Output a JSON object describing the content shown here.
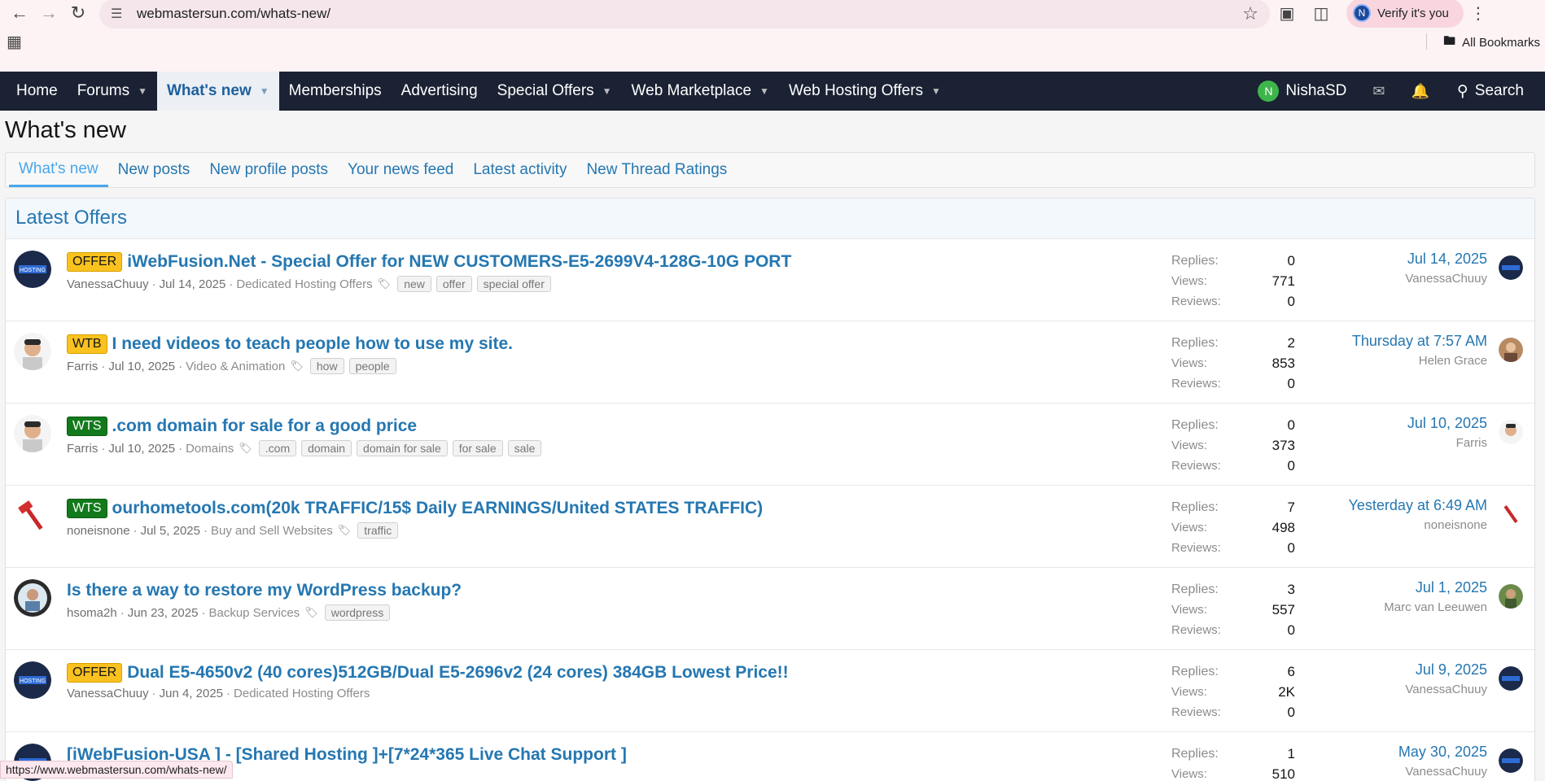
{
  "browser": {
    "url": "webmastersun.com/whats-new/",
    "profile_label": "Verify it's you",
    "profile_initial": "N",
    "all_bookmarks": "All Bookmarks",
    "status_url": "https://www.webmastersun.com/whats-new/"
  },
  "nav": {
    "items": [
      {
        "label": "Home"
      },
      {
        "label": "Forums"
      },
      {
        "label": "What's new"
      },
      {
        "label": "Memberships"
      },
      {
        "label": "Advertising"
      },
      {
        "label": "Special Offers"
      },
      {
        "label": "Web Marketplace"
      },
      {
        "label": "Web Hosting Offers"
      }
    ],
    "user_initial": "N",
    "username": "NishaSD",
    "search_label": "Search"
  },
  "page": {
    "title": "What's new",
    "tabs": [
      {
        "label": "What's new"
      },
      {
        "label": "New posts"
      },
      {
        "label": "New profile posts"
      },
      {
        "label": "Your news feed"
      },
      {
        "label": "Latest activity"
      },
      {
        "label": "New Thread Ratings"
      }
    ],
    "block_title": "Latest Offers"
  },
  "labels": {
    "replies": "Replies:",
    "views": "Views:",
    "reviews": "Reviews:"
  },
  "threads": [
    {
      "prefix": "OFFER",
      "title": "iWebFusion.Net - Special Offer for NEW CUSTOMERS-E5-2699V4-128G-10G PORT",
      "author": "VanessaChuuy",
      "date": "Jul 14, 2025",
      "forum": "Dedicated Hosting Offers",
      "tags": [
        "new",
        "offer",
        "special offer"
      ],
      "replies": "0",
      "views": "771",
      "reviews": "0",
      "last_date": "Jul 14, 2025",
      "last_user": "VanessaChuuy"
    },
    {
      "prefix": "WTB",
      "title": "I need videos to teach people how to use my site.",
      "author": "Farris",
      "date": "Jul 10, 2025",
      "forum": "Video & Animation",
      "tags": [
        "how",
        "people"
      ],
      "replies": "2",
      "views": "853",
      "reviews": "0",
      "last_date": "Thursday at 7:57 AM",
      "last_user": "Helen Grace"
    },
    {
      "prefix": "WTS",
      "title": ".com domain for sale for a good price",
      "author": "Farris",
      "date": "Jul 10, 2025",
      "forum": "Domains",
      "tags": [
        ".com",
        "domain",
        "domain for sale",
        "for sale",
        "sale"
      ],
      "replies": "0",
      "views": "373",
      "reviews": "0",
      "last_date": "Jul 10, 2025",
      "last_user": "Farris"
    },
    {
      "prefix": "WTS",
      "title": "ourhometools.com(20k TRAFFIC/15$ Daily EARNINGS/United STATES TRAFFIC)",
      "author": "noneisnone",
      "date": "Jul 5, 2025",
      "forum": "Buy and Sell Websites",
      "tags": [
        "traffic"
      ],
      "replies": "7",
      "views": "498",
      "reviews": "0",
      "last_date": "Yesterday at 6:49 AM",
      "last_user": "noneisnone"
    },
    {
      "prefix": "",
      "title": "Is there a way to restore my WordPress backup?",
      "author": "hsoma2h",
      "date": "Jun 23, 2025",
      "forum": "Backup Services",
      "tags": [
        "wordpress"
      ],
      "replies": "3",
      "views": "557",
      "reviews": "0",
      "last_date": "Jul 1, 2025",
      "last_user": "Marc van Leeuwen"
    },
    {
      "prefix": "OFFER",
      "title": "Dual E5-4650v2  (40 cores)512GB/Dual E5-2696v2 (24 cores) 384GB Lowest Price!!",
      "author": "VanessaChuuy",
      "date": "Jun 4, 2025",
      "forum": "Dedicated Hosting Offers",
      "tags": [],
      "replies": "6",
      "views": "2K",
      "reviews": "0",
      "last_date": "Jul 9, 2025",
      "last_user": "VanessaChuuy"
    },
    {
      "prefix": "",
      "title": "[iWebFusion-USA ] - [Shared Hosting ]+[7*24*365 Live Chat Support ]",
      "author": "",
      "date": "",
      "forum": "",
      "tags": [],
      "replies": "1",
      "views": "510",
      "reviews": "",
      "last_date": "May 30, 2025",
      "last_user": "VanessaChuuy"
    }
  ]
}
